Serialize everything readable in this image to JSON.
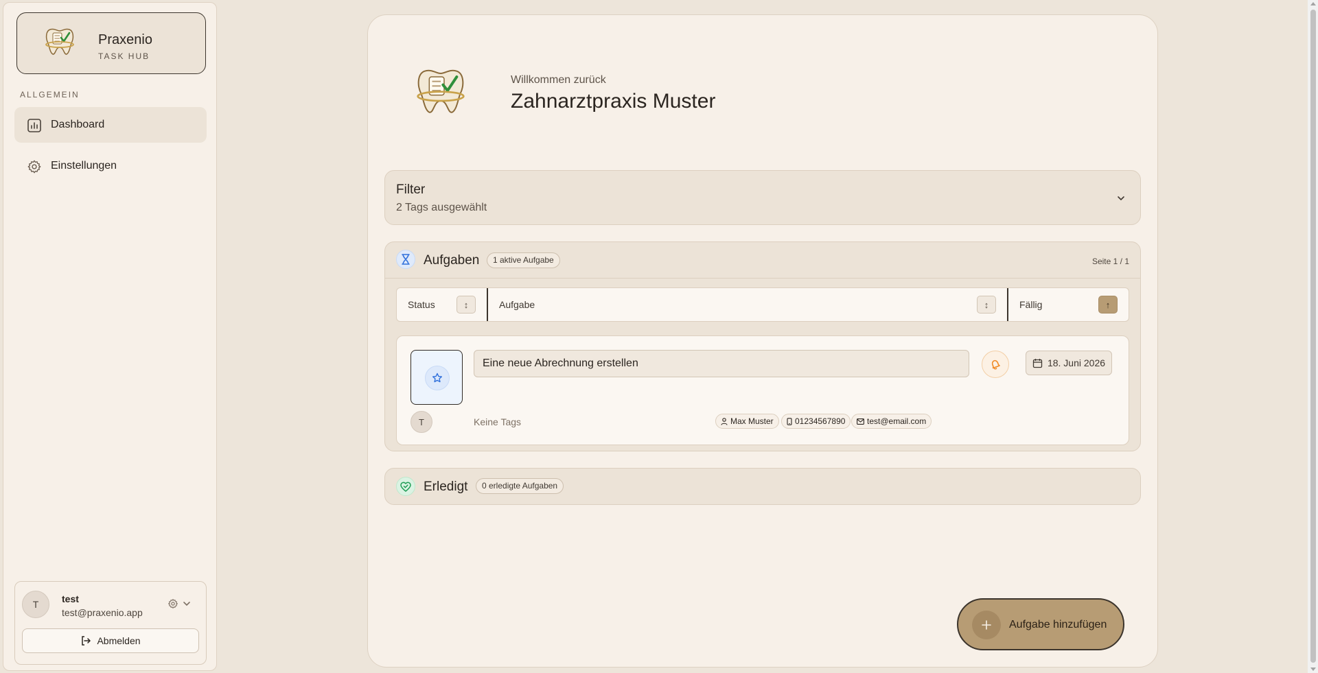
{
  "brand": {
    "name": "Praxenio",
    "subtitle": "TASK HUB",
    "logo_icon": "tooth-checklist-icon"
  },
  "sidebar": {
    "section_label": "ALLGEMEIN",
    "items": [
      {
        "label": "Dashboard",
        "icon": "bar-chart-icon",
        "active": true
      },
      {
        "label": "Einstellungen",
        "icon": "gear-icon",
        "active": false
      }
    ]
  },
  "user": {
    "initial": "T",
    "name": "test",
    "email": "test@praxenio.app",
    "logout_label": "Abmelden"
  },
  "header": {
    "welcome": "Willkommen zurück",
    "practice_name": "Zahnarztpraxis Muster"
  },
  "filter": {
    "title": "Filter",
    "summary": "2 Tags ausgewählt"
  },
  "tasks": {
    "title": "Aufgaben",
    "badge": "1 aktive Aufgabe",
    "page_info": "Seite 1 / 1",
    "columns": [
      {
        "label": "Status",
        "sort_symbol": "↕"
      },
      {
        "label": "Aufgabe",
        "sort_symbol": "↕"
      },
      {
        "label": "Fällig",
        "sort_symbol": "↑"
      }
    ],
    "rows": [
      {
        "title": "Eine neue Abrechnung erstellen",
        "due": "18. Juni 2026",
        "assignee_initial": "T",
        "tags_text": "Keine Tags",
        "contact_name": "Max Muster",
        "contact_phone": "01234567890",
        "contact_email": "test@email.com"
      }
    ]
  },
  "done": {
    "title": "Erledigt",
    "badge": "0 erledigte Aufgaben"
  },
  "fab": {
    "label": "Aufgabe hinzufügen"
  },
  "colors": {
    "background": "#ede5da",
    "panel": "#f7f0e8",
    "accent": "#b79c74",
    "status_blue": "#2f6fdb",
    "done_green": "#1f9d55",
    "priority_orange": "#f08a24"
  }
}
